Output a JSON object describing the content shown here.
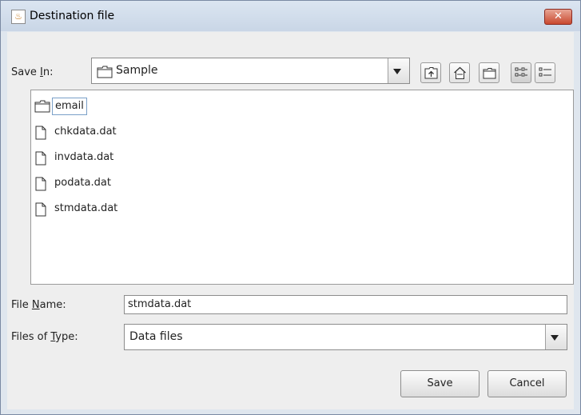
{
  "window": {
    "title": "Destination file"
  },
  "save_in": {
    "label_prefix": "Save ",
    "label_mnemonic": "I",
    "label_suffix": "n:",
    "value": "Sample"
  },
  "toolbar": {
    "buttons": [
      {
        "name": "up-one-level",
        "icon": "folder-up-icon"
      },
      {
        "name": "home",
        "icon": "home-icon"
      },
      {
        "name": "new-folder",
        "icon": "new-folder-icon"
      },
      {
        "name": "list-view",
        "icon": "list-view-icon"
      },
      {
        "name": "details-view",
        "icon": "details-view-icon"
      }
    ]
  },
  "files": [
    {
      "name": "email",
      "type": "folder"
    },
    {
      "name": "chkdata.dat",
      "type": "file"
    },
    {
      "name": "invdata.dat",
      "type": "file"
    },
    {
      "name": "podata.dat",
      "type": "file"
    },
    {
      "name": "stmdata.dat",
      "type": "file"
    }
  ],
  "file_name": {
    "label_prefix": "File ",
    "label_mnemonic": "N",
    "label_suffix": "ame:",
    "value": "stmdata.dat"
  },
  "file_type": {
    "label_prefix": "Files of ",
    "label_mnemonic": "T",
    "label_suffix": "ype:",
    "value": "Data files"
  },
  "actions": {
    "save_label": "Save",
    "cancel_label": "Cancel"
  }
}
